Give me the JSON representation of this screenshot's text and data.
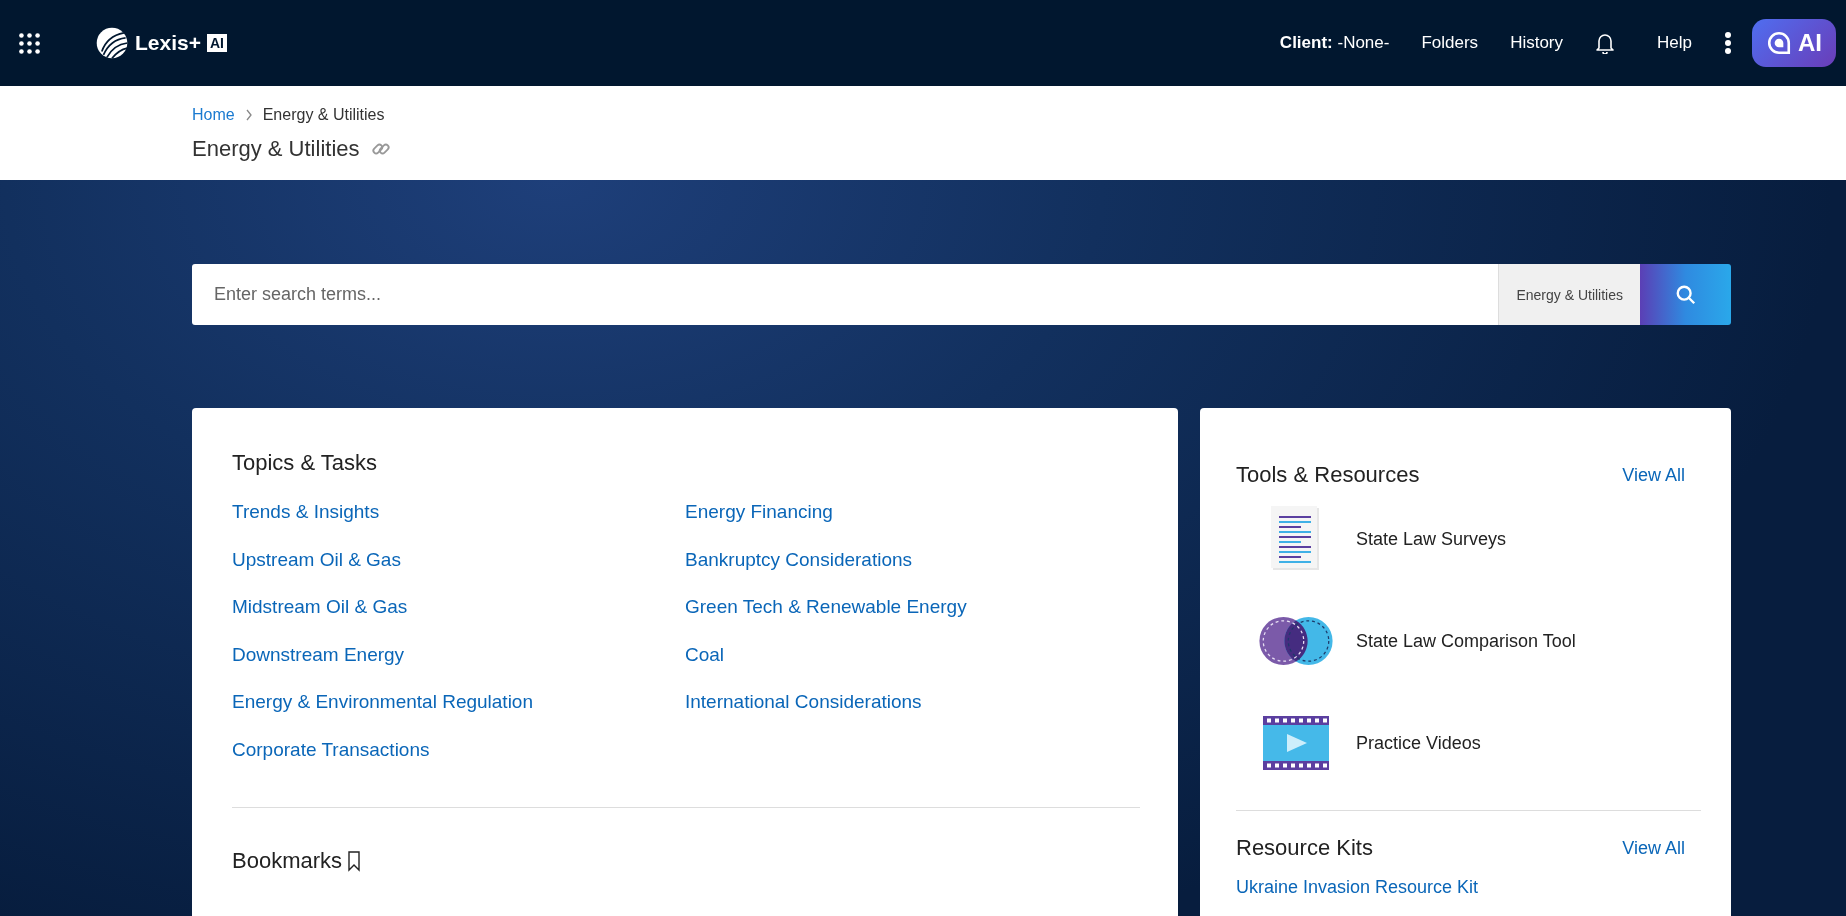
{
  "header": {
    "brand": "Lexis+",
    "brand_badge": "AI",
    "nav": [
      {
        "kind": "client",
        "label": "Client:",
        "value": "-None-"
      },
      {
        "kind": "link",
        "label": "Folders"
      },
      {
        "kind": "link",
        "label": "History"
      },
      {
        "kind": "bell"
      },
      {
        "kind": "link",
        "label": "Help"
      },
      {
        "kind": "more"
      }
    ],
    "ai_button": "AI"
  },
  "breadcrumb": [
    {
      "kind": "link",
      "label": "Home"
    },
    {
      "kind": "current",
      "label": "Energy & Utilities"
    }
  ],
  "page_title": "Energy & Utilities",
  "search": {
    "placeholder": "Enter search terms...",
    "scope": "Energy & Utilities"
  },
  "topics": {
    "title": "Topics & Tasks",
    "columns": [
      [
        "Trends & Insights",
        "Upstream Oil & Gas",
        "Midstream Oil & Gas",
        "Downstream Energy",
        "Energy & Environmental Regulation",
        "Corporate Transactions"
      ],
      [
        "Energy Financing",
        "Bankruptcy Considerations",
        "Green Tech & Renewable Energy",
        "Coal",
        "International Considerations"
      ]
    ]
  },
  "bookmarks": {
    "title": "Bookmarks"
  },
  "tools": {
    "title": "Tools & Resources",
    "view_all": "View All",
    "items": [
      {
        "kind": "survey",
        "label": "State Law Surveys"
      },
      {
        "kind": "venn",
        "label": "State Law Comparison Tool"
      },
      {
        "kind": "video",
        "label": "Practice Videos"
      }
    ]
  },
  "resource_kits": {
    "title": "Resource Kits",
    "view_all": "View All",
    "items": [
      "Ukraine Invasion Resource Kit"
    ]
  }
}
